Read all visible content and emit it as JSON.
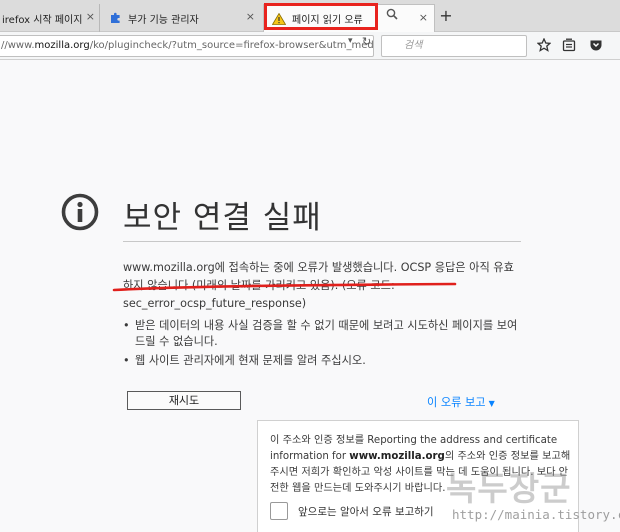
{
  "tabs": [
    {
      "label": "irefox 시작 페이지",
      "close": "×"
    },
    {
      "label": "부가 기능 관리자",
      "close": "×"
    },
    {
      "label": "페이지 읽기 오류",
      "close": "×"
    }
  ],
  "new_tab": "+",
  "url_bar": {
    "prefix": "//www.",
    "domain": "mozilla.org",
    "path": "/ko/plugincheck/?utm_source=firefox-browser&utm_mediu",
    "dropdown": "▾",
    "reload": "↻"
  },
  "search": {
    "placeholder": "검색"
  },
  "icons": {
    "bookmark": "bookmark-star-icon",
    "library": "library-icon",
    "pocket": "pocket-icon"
  },
  "error": {
    "title": "보안 연결 실패",
    "line1": "www.mozilla.org에 접속하는 중에 오류가 발생했습니다. OCSP 응답은 아직 유효하지 않습니다 (미래의 날짜를 가리키고 있음). (오류 코드:",
    "code": "sec_error_ocsp_future_response)",
    "bullet1": "받은 데이터의 내용 사실 검증을 할 수 없기 때문에 보려고 시도하신 페이지를 보여드릴 수 없습니다.",
    "bullet2": "웹 사이트 관리자에게 현재 문제를 알려 주십시오."
  },
  "retry_label": "재시도",
  "report_link": "이 오류 보고",
  "report_box": {
    "text_before": "이 주소와 인증 정보를 Reporting the address and certificate information for ",
    "domain": "www.mozilla.org",
    "text_after": "의 주소와 인증 정보를 보고해주시면 저희가 확인하고 악성 사이트를 막는 데 도움이 됩니다. 보다 안전한 웹을 만드는데 도와주시기 바랍니다.",
    "checkbox_label": "앞으로는 알아서 오류 보고하기"
  },
  "watermark": {
    "main": "녹두장군",
    "url": "http://mainia.tistory.com"
  },
  "colors": {
    "highlight": "#e8231e",
    "link": "#0a84ff",
    "underline": "#e0201c"
  }
}
